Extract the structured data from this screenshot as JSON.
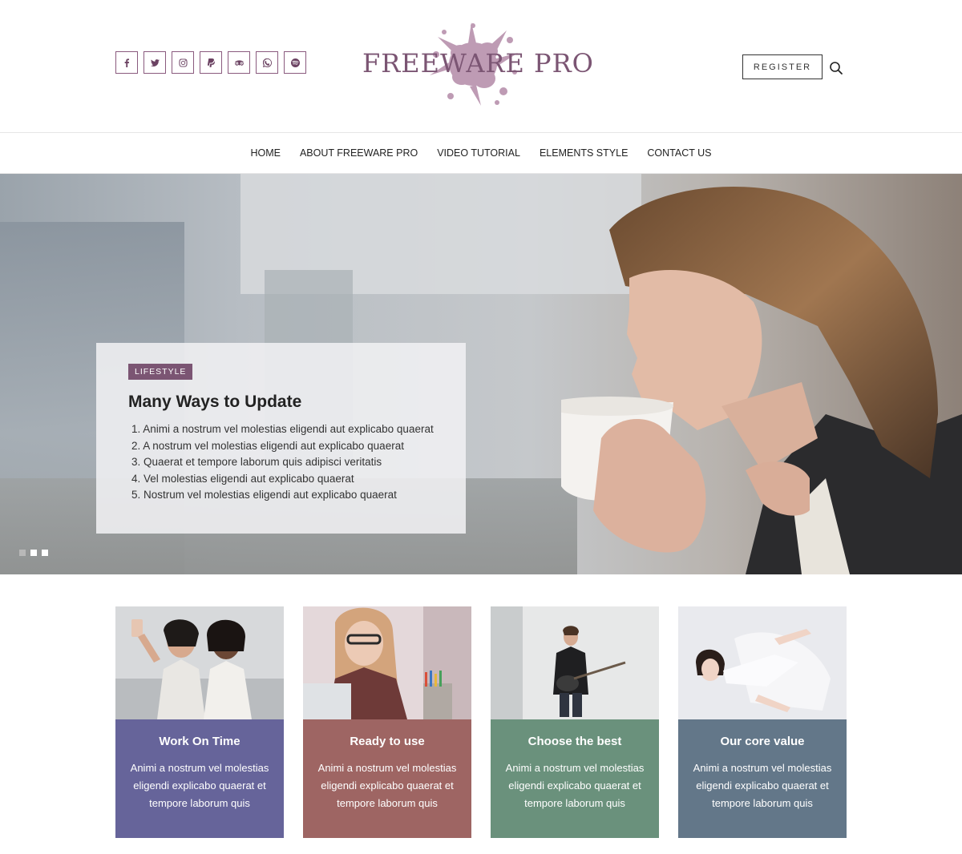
{
  "header": {
    "logo_text": "FREEWARE PRO",
    "register_label": "REGISTER",
    "social_icons": [
      "facebook-icon",
      "twitter-icon",
      "instagram-icon",
      "paypal-icon",
      "tripadvisor-icon",
      "whatsapp-icon",
      "spotify-icon"
    ],
    "accent_color": "#7b5573"
  },
  "nav": {
    "items": [
      "HOME",
      "ABOUT FREEWARE PRO",
      "VIDEO TUTORIAL",
      "ELEMENTS STYLE",
      "CONTACT US"
    ]
  },
  "hero": {
    "category": "LIFESTYLE",
    "title": "Many Ways to Update",
    "list": [
      "1. Animi a nostrum vel molestias eligendi aut explicabo quaerat",
      "2. A nostrum vel molestias eligendi aut explicabo quaerat",
      "3. Quaerat et tempore laborum quis adipisci veritatis",
      "4. Vel molestias eligendi aut explicabo quaerat",
      "5. Nostrum vel molestias eligendi aut explicabo quaerat"
    ],
    "slides": 3,
    "active_slide": 1
  },
  "cards": [
    {
      "title": "Work On Time",
      "description": "Animi a nostrum vel molestias eligendi explicabo quaerat et tempore laborum quis",
      "color": "#66649a"
    },
    {
      "title": "Ready to use",
      "description": "Animi a nostrum vel molestias eligendi explicabo quaerat et tempore laborum quis",
      "color": "#9e6563"
    },
    {
      "title": "Choose the best",
      "description": "Animi a nostrum vel molestias eligendi explicabo quaerat et tempore laborum quis",
      "color": "#6a917c"
    },
    {
      "title": "Our core value",
      "description": "Animi a nostrum vel molestias eligendi explicabo quaerat et tempore laborum quis",
      "color": "#637789"
    }
  ]
}
